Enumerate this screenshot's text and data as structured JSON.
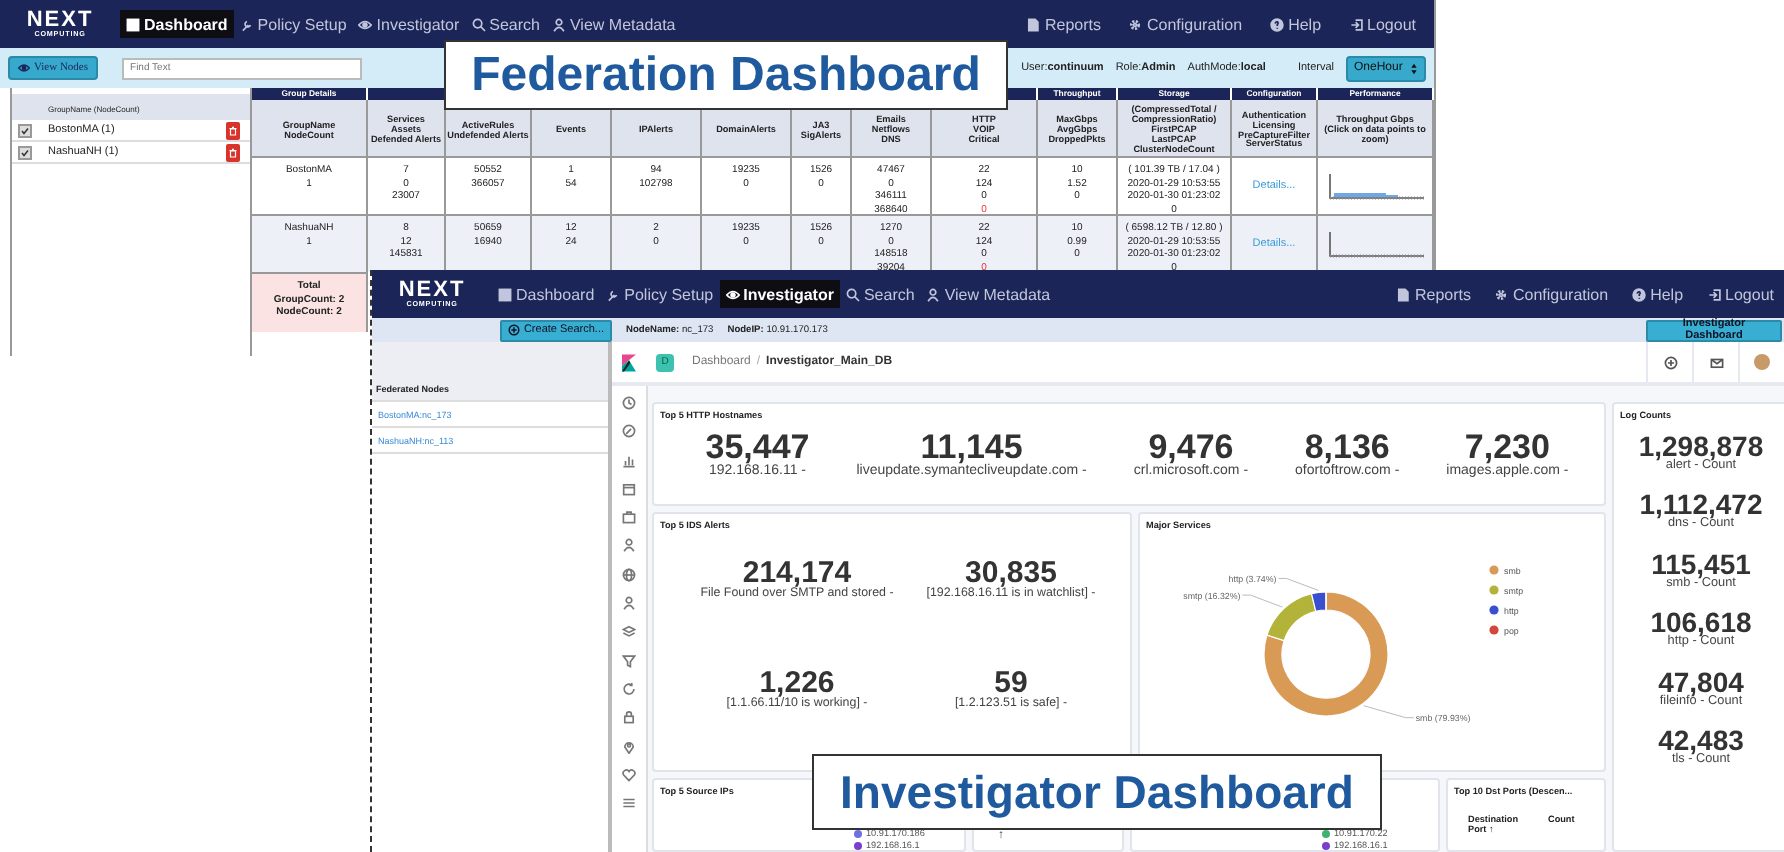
{
  "federation": {
    "nav": {
      "logo_top": "NEXT",
      "logo_bottom": "COMPUTING",
      "items": [
        {
          "label": "Dashboard",
          "selected": true
        },
        {
          "label": "Policy Setup",
          "selected": false
        },
        {
          "label": "Investigator",
          "selected": false
        },
        {
          "label": "Search",
          "selected": false
        },
        {
          "label": "View Metadata",
          "selected": false
        }
      ],
      "right": [
        "Reports",
        "Configuration",
        "Help",
        "Logout"
      ]
    },
    "toolbar": {
      "view_nodes": "View Nodes",
      "find_placeholder": "Find Text",
      "user": "User:**continuum**",
      "role": "Role:**Admin**",
      "auth": "AuthMode:**local**",
      "interval_label": "Interval",
      "interval": "OneHour"
    },
    "groups": {
      "header": "GroupName (NodeCount)",
      "items": [
        {
          "name": "BostonMA (1)",
          "checked": true
        },
        {
          "name": "NashuaNH (1)",
          "checked": true
        }
      ]
    },
    "table": {
      "column_groups": [
        {
          "label": "Group Details",
          "columns": [
            [
              "GroupName",
              "NodeCount"
            ]
          ]
        },
        {
          "columns": [
            [
              "Services",
              "Assets",
              "Defended Alerts"
            ],
            [
              "ActiveRules",
              "Undefended Alerts"
            ],
            [
              "Events"
            ],
            [
              "IPAlerts"
            ],
            [
              "DomainAlerts"
            ],
            [
              "JA3 SigAlerts"
            ],
            [
              "Emails",
              "Netflows",
              "DNS"
            ],
            [
              "HTTP",
              "VOIP",
              "Critical"
            ]
          ]
        },
        {
          "label": "Throughput",
          "columns": [
            [
              "MaxGbps",
              "AvgGbps",
              "DroppedPkts"
            ]
          ]
        },
        {
          "label": "Storage",
          "columns": [
            [
              "(CompressedTotal /",
              "CompressionRatio)",
              "FirstPCAP",
              "LastPCAP",
              "ClusterNodeCount"
            ]
          ]
        },
        {
          "label": "Configuration",
          "columns": [
            [
              "Authentication",
              "Licensing",
              "PreCaptureFilter",
              "ServerStatus"
            ]
          ]
        },
        {
          "label": "Performance",
          "columns": [
            [
              "Throughput Gbps",
              "(Click on data points to zoom)"
            ]
          ]
        }
      ],
      "rows": [
        {
          "cells": [
            {
              "kind": "text",
              "lines": [
                "BostonMA",
                "1"
              ]
            },
            {
              "kind": "text",
              "lines": [
                "7",
                "0",
                "23007"
              ]
            },
            {
              "kind": "text",
              "lines": [
                "50552",
                "366057"
              ]
            },
            {
              "kind": "text",
              "lines": [
                "1",
                "54"
              ]
            },
            {
              "kind": "text",
              "lines": [
                "94",
                "102798"
              ]
            },
            {
              "kind": "text",
              "lines": [
                "19235",
                "0"
              ]
            },
            {
              "kind": "text",
              "lines": [
                "1526",
                "0"
              ]
            },
            {
              "kind": "text",
              "lines": [
                "47467",
                "0",
                "346111",
                "368640"
              ]
            },
            {
              "kind": "text",
              "lines": [
                "22",
                "124",
                "0"
              ],
              "critical": "0"
            },
            {
              "kind": "text",
              "lines": [
                "10",
                "1.52",
                "0"
              ]
            },
            {
              "kind": "text",
              "lines": [
                "( 101.39 TB / 17.04 )",
                "2020-01-29 10:53:55",
                "2020-01-30 01:23:02",
                "0"
              ]
            },
            {
              "kind": "link",
              "text": "Details..."
            },
            {
              "kind": "sparkline",
              "busy": true
            }
          ]
        },
        {
          "cells": [
            {
              "kind": "text",
              "lines": [
                "NashuaNH",
                "1"
              ]
            },
            {
              "kind": "text",
              "lines": [
                "8",
                "12",
                "145831"
              ]
            },
            {
              "kind": "text",
              "lines": [
                "50659",
                "16940"
              ]
            },
            {
              "kind": "text",
              "lines": [
                "12",
                "24"
              ]
            },
            {
              "kind": "text",
              "lines": [
                "2",
                "0"
              ]
            },
            {
              "kind": "text",
              "lines": [
                "19235",
                "0"
              ]
            },
            {
              "kind": "text",
              "lines": [
                "1526",
                "0"
              ]
            },
            {
              "kind": "text",
              "lines": [
                "1270",
                "0",
                "148518",
                "39204"
              ]
            },
            {
              "kind": "text",
              "lines": [
                "22",
                "124",
                "0"
              ],
              "critical": "0"
            },
            {
              "kind": "text",
              "lines": [
                "10",
                "0.99",
                "0"
              ]
            },
            {
              "kind": "text",
              "lines": [
                "( 6598.12 TB / 12.80 )",
                "2020-01-29 10:53:55",
                "2020-01-30 01:23:02",
                "0"
              ]
            },
            {
              "kind": "link",
              "text": "Details..."
            },
            {
              "kind": "sparkline",
              "busy": false
            }
          ]
        }
      ],
      "total": [
        "Total",
        "GroupCount: 2",
        "NodeCount: 2"
      ]
    }
  },
  "investigator": {
    "nav": {
      "logo_top": "NEXT",
      "logo_bottom": "COMPUTING",
      "items": [
        {
          "label": "Dashboard",
          "selected": false
        },
        {
          "label": "Policy Setup",
          "selected": false
        },
        {
          "label": "Investigator",
          "selected": true
        },
        {
          "label": "Search",
          "selected": false
        },
        {
          "label": "View Metadata",
          "selected": false
        }
      ],
      "right": [
        "Reports",
        "Configuration",
        "Help",
        "Logout"
      ]
    },
    "subbar": {
      "create_search": "Create Search...",
      "node_name": "**NodeName:** nc_173",
      "node_ip": "**NodeIP:** 10.91.170.173",
      "dashboard_button": "Investigator Dashboard"
    },
    "federated_nodes": {
      "header": "Federated Nodes",
      "items": [
        "BostonMA:nc_173",
        "NashuaNH:nc_113"
      ]
    },
    "kibana": {
      "badge": "D",
      "breadcrumb": [
        "Dashboard",
        "Investigator_Main_DB"
      ],
      "separator": "/"
    },
    "http_hostnames": {
      "title": "Top 5 HTTP Hostnames",
      "metrics": [
        {
          "value": "35,447",
          "label": "192.168.16.11 -"
        },
        {
          "value": "11,145",
          "label": "liveupdate.symantecliveupdate.com -"
        },
        {
          "value": "9,476",
          "label": "crl.microsoft.com -"
        },
        {
          "value": "8,136",
          "label": "ofortoftrow.com -"
        },
        {
          "value": "7,230",
          "label": "images.apple.com -"
        }
      ]
    },
    "ids_alerts": {
      "title": "Top 5 IDS Alerts",
      "metrics": [
        {
          "value": "214,174",
          "label": "File Found over SMTP and stored -"
        },
        {
          "value": "30,835",
          "label": "[192.168.16.11 is in watchlist] -"
        },
        {
          "value": "1,226",
          "label": "[1.1.66.11/10 is working] -"
        },
        {
          "value": "59",
          "label": "[1.2.123.51 is safe] -"
        }
      ]
    },
    "major_services": {
      "title": "Major Services",
      "slices": [
        {
          "color": "#d99a55"
        },
        {
          "color": "#b3b33a"
        },
        {
          "color": "#3a4fcf"
        },
        {
          "color": "#d2473b"
        }
      ],
      "chart_data": {
        "type": "donut",
        "categories": [
          "smb",
          "smtp",
          "http",
          "pop"
        ],
        "values": [
          79.93,
          16.32,
          3.74,
          0.01
        ],
        "legend": "right",
        "annotations": [
          {
            "x": "http",
            "text": "http (3.74%)"
          },
          {
            "x": "smtp",
            "text": "smtp (16.32%)"
          },
          {
            "x": "smb",
            "text": "smb (79.93%)"
          }
        ]
      }
    },
    "log_counts": {
      "title": "Log Counts",
      "metrics": [
        {
          "value": "1,298,878",
          "label": "alert - Count"
        },
        {
          "value": "1,112,472",
          "label": "dns - Count"
        },
        {
          "value": "115,451",
          "label": "smb - Count"
        },
        {
          "value": "106,618",
          "label": "http - Count"
        },
        {
          "value": "47,804",
          "label": "fileinfo - Count"
        },
        {
          "value": "42,483",
          "label": "tls - Count"
        }
      ]
    },
    "source_ips": {
      "title": "Top 5 Source IPs",
      "legend": [
        {
          "label": "10.91.170.186",
          "color": "#6f6fe0"
        },
        {
          "label": "192.168.16.1",
          "color": "#7b3fd0"
        }
      ]
    },
    "panel_2": {
      "sort_arrow": "↑"
    },
    "panel_3": {
      "legend": [
        {
          "label": "10.91.170.22",
          "color": "#3cb371"
        },
        {
          "label": "192.168.16.1",
          "color": "#7b3fd0"
        }
      ]
    },
    "dst_ports": {
      "title": "Top 10 Dst Ports (Descen...",
      "columns": [
        "Destination Port ↑",
        "Count"
      ]
    }
  },
  "callouts": [
    "Federation Dashboard",
    "Investigator Dashboard"
  ]
}
